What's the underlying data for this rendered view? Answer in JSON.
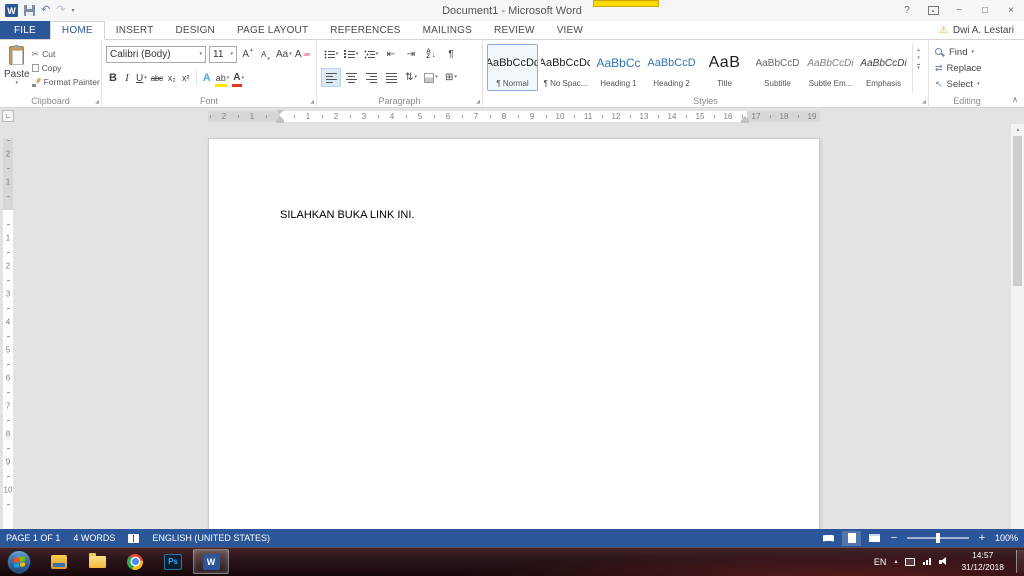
{
  "icons": {
    "caret_down": "▾",
    "caret_up": "▴",
    "undo": "↶",
    "redo": "↷",
    "warning": "⚠",
    "scissors": "✂",
    "pilcrow": "¶",
    "line_spacing": "⇅",
    "outdent": "⇤",
    "indent": "⇥",
    "borders": "⊞",
    "chevron_up": "∧",
    "tab_stop": "∟",
    "select_pointer": "↖",
    "replace": "⇄",
    "sort_arrow": "↓",
    "launcher": "◢",
    "scroll_up": "▴",
    "scroll_down": "▾",
    "help": "?",
    "minimize": "−",
    "restore": "□",
    "close": "×",
    "zoom_out": "−",
    "zoom_in": "+"
  },
  "title_bar": {
    "app_letter": "W",
    "title": "Document1 - Microsoft Word"
  },
  "account": {
    "name": "Dwi A. Lestari"
  },
  "tabs": [
    {
      "label": "FILE"
    },
    {
      "label": "HOME"
    },
    {
      "label": "INSERT"
    },
    {
      "label": "DESIGN"
    },
    {
      "label": "PAGE LAYOUT"
    },
    {
      "label": "REFERENCES"
    },
    {
      "label": "MAILINGS"
    },
    {
      "label": "REVIEW"
    },
    {
      "label": "VIEW"
    }
  ],
  "clipboard": {
    "group_label": "Clipboard",
    "paste": "Paste",
    "cut": "Cut",
    "copy": "Copy",
    "format_painter": "Format Painter"
  },
  "font": {
    "group_label": "Font",
    "name": "Calibri (Body)",
    "size": "11",
    "bold": "B",
    "italic": "I",
    "underline": "U",
    "strike": "abc",
    "subscript": "x₂",
    "superscript": "x²",
    "change_case": "Aa",
    "grow": "A",
    "shrink": "A",
    "clear": "A",
    "effects": "A",
    "highlight": "ab",
    "color": "A"
  },
  "paragraph": {
    "group_label": "Paragraph",
    "sort_a": "A",
    "sort_z": "Z"
  },
  "styles": {
    "group_label": "Styles",
    "items": [
      {
        "preview": "AaBbCcDc",
        "name": "¶ Normal"
      },
      {
        "preview": "AaBbCcDc",
        "name": "¶ No Spac..."
      },
      {
        "preview": "AaBbCc",
        "name": "Heading 1"
      },
      {
        "preview": "AaBbCcD",
        "name": "Heading 2"
      },
      {
        "preview": "AaB",
        "name": "Title"
      },
      {
        "preview": "AaBbCcD",
        "name": "Subtitle"
      },
      {
        "preview": "AaBbCcDi",
        "name": "Subtle Em..."
      },
      {
        "preview": "AaBbCcDi",
        "name": "Emphasis"
      }
    ]
  },
  "editing": {
    "group_label": "Editing",
    "find": "Find",
    "replace": "Replace",
    "select": "Select"
  },
  "ruler": {
    "h_margin": [
      "2",
      "1"
    ],
    "h_main": [
      "1",
      "2",
      "3",
      "4",
      "5",
      "6",
      "7",
      "8",
      "9",
      "10",
      "11",
      "12",
      "13",
      "14",
      "15",
      "16",
      "17",
      "18",
      "19"
    ],
    "v_margin": [
      "2",
      "1"
    ],
    "v_main": [
      "1",
      "2",
      "3",
      "4",
      "5",
      "6",
      "7",
      "8",
      "9",
      "10"
    ]
  },
  "document": {
    "text": "SILAHKAN BUKA LINK INI."
  },
  "status_bar": {
    "page_info": "PAGE 1 OF 1",
    "word_count": "4 WORDS",
    "language": "ENGLISH (UNITED STATES)",
    "zoom": "100%"
  },
  "taskbar": {
    "language": "EN",
    "time": "14:57",
    "date": "31/12/2018",
    "word_label": "W",
    "photoshop_label": "Ps"
  },
  "colors": {
    "accent": "#2B579A",
    "overlay_yellow": "#FFD800"
  }
}
